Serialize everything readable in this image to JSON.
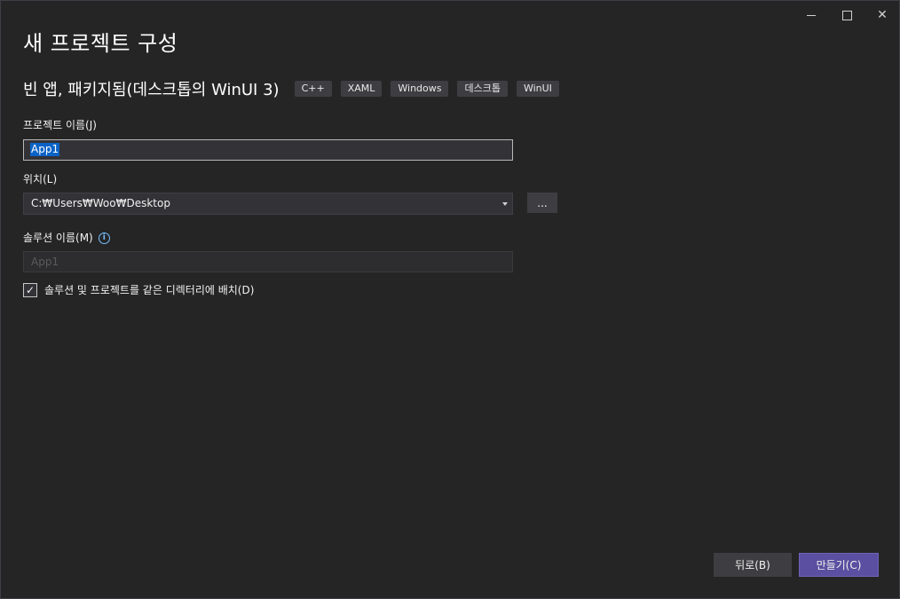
{
  "window": {
    "title": "새 프로젝트 구성"
  },
  "template": {
    "name": "빈 앱, 패키지됨(데스크톱의 WinUI 3)",
    "tags": [
      "C++",
      "XAML",
      "Windows",
      "데스크톱",
      "WinUI"
    ]
  },
  "form": {
    "project_name_label": "프로젝트 이름(J)",
    "project_name_value": "App1",
    "location_label": "위치(L)",
    "location_value": "C:₩Users₩Woo₩Desktop",
    "browse_label": "...",
    "solution_name_label": "솔루션 이름(M)",
    "solution_name_value": "App1",
    "same_dir_label": "솔루션 및 프로젝트를 같은 디렉터리에 배치(D)",
    "same_dir_checked": true
  },
  "footer": {
    "back_label": "뒤로(B)",
    "create_label": "만들기(C)"
  },
  "icons": {
    "minimize": "minimize-icon",
    "maximize": "maximize-icon",
    "close": "close-icon",
    "info": "info-icon",
    "checkmark": "checkmark-icon",
    "dropdown": "chevron-down-icon"
  },
  "colors": {
    "background": "#252526",
    "accent": "#5a4fa0",
    "selection": "#0b63c7",
    "info": "#75beff"
  }
}
